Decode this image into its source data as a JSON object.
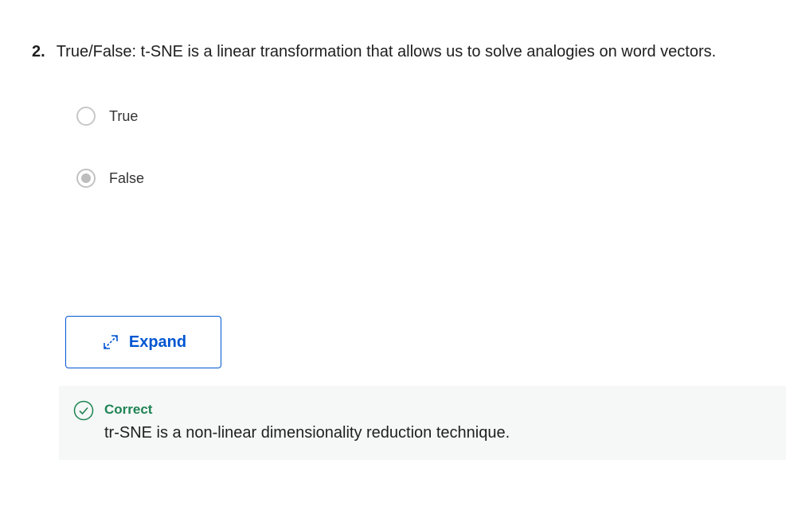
{
  "question": {
    "number": "2.",
    "text": "True/False: t-SNE is a linear transformation that allows us to solve analogies on word vectors."
  },
  "options": [
    {
      "label": "True",
      "selected": false
    },
    {
      "label": "False",
      "selected": true
    }
  ],
  "expand_button": {
    "label": "Expand",
    "icon": "expand-arrows-icon"
  },
  "feedback": {
    "status": "Correct",
    "icon": "check-circle-icon",
    "text": "tr-SNE is a non-linear dimensionality reduction technique."
  },
  "colors": {
    "accent": "#0056d2",
    "correct": "#1f8354",
    "feedback_bg": "#f5f8f6"
  }
}
